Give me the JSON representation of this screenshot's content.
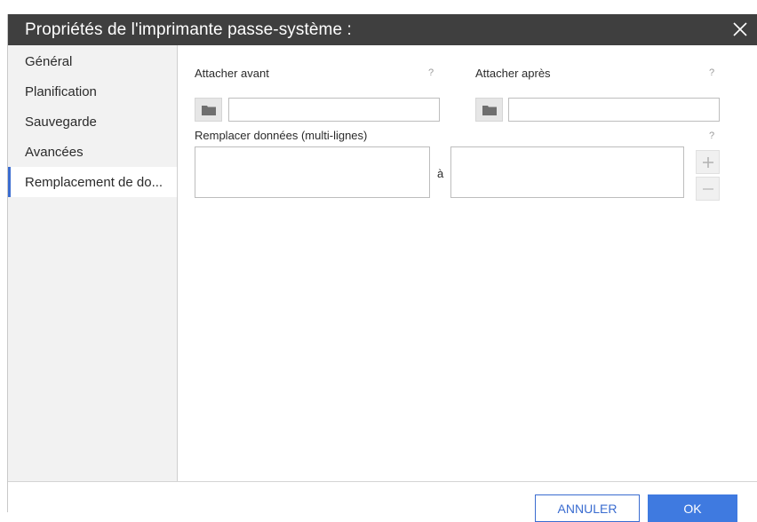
{
  "dialog": {
    "title": "Propriétés de l'imprimante passe-système :",
    "close_icon": "close-icon"
  },
  "sidebar": {
    "items": [
      {
        "label": "Général",
        "active": false
      },
      {
        "label": "Planification",
        "active": false
      },
      {
        "label": "Sauvegarde",
        "active": false
      },
      {
        "label": "Avancées",
        "active": false
      },
      {
        "label": "Remplacement de do...",
        "active": true
      }
    ]
  },
  "main": {
    "attach_before": {
      "label": "Attacher avant",
      "help": "?",
      "value": "",
      "icon": "folder-icon"
    },
    "attach_after": {
      "label": "Attacher après",
      "help": "?",
      "value": "",
      "icon": "folder-icon"
    },
    "replace_data": {
      "label": "Remplacer données (multi-lignes)",
      "help": "?",
      "from_value": "",
      "separator": "à",
      "to_value": "",
      "add_icon": "plus-icon",
      "remove_icon": "minus-icon"
    }
  },
  "footer": {
    "cancel_label": "ANNULER",
    "ok_label": "OK"
  },
  "colors": {
    "titlebar": "#3f3f3f",
    "accent": "#3a6cd0",
    "ok_button": "#3f7ae0",
    "sidebar_bg": "#f2f2f2"
  }
}
